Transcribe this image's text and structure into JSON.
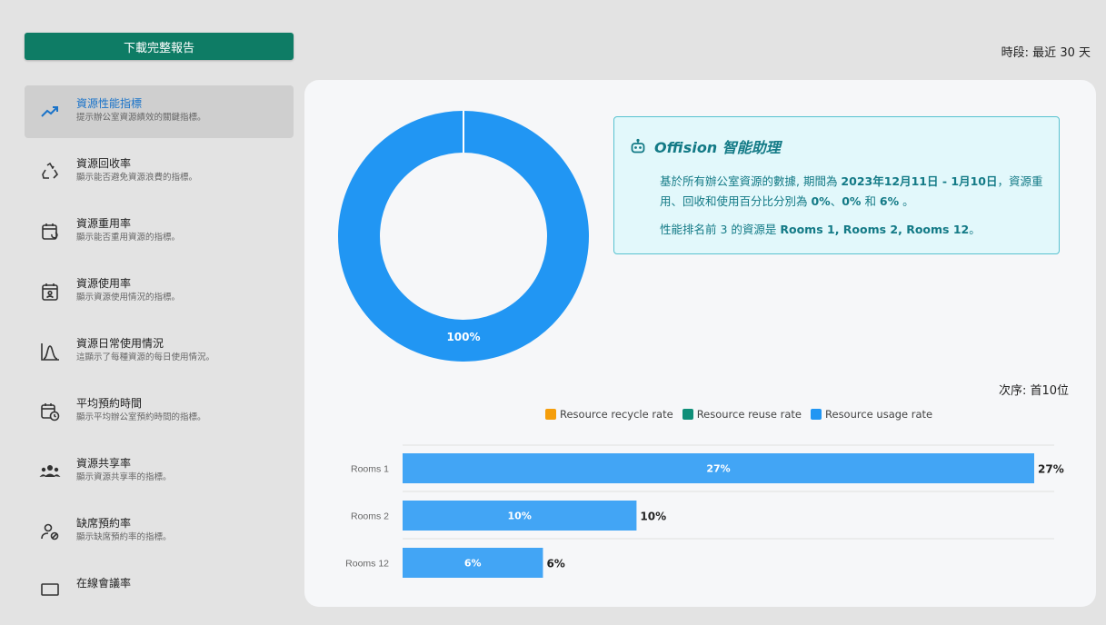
{
  "download_label": "下載完整報告",
  "period": "時段: 最近 30 天",
  "sidebar": [
    {
      "title": "資源性能指標",
      "desc": "提示辦公室資源績效的關鍵指標。",
      "icon": "trending-up-icon",
      "active": true
    },
    {
      "title": "資源回收率",
      "desc": "顯示能否避免資源浪費的指標。",
      "icon": "recycle-icon",
      "active": false
    },
    {
      "title": "資源重用率",
      "desc": "顯示能否重用資源的指標。",
      "icon": "calendar-reuse-icon",
      "active": false
    },
    {
      "title": "資源使用率",
      "desc": "顯示資源使用情況的指標。",
      "icon": "calendar-user-icon",
      "active": false
    },
    {
      "title": "資源日常使用情況",
      "desc": "這顯示了每種資源的每日使用情況。",
      "icon": "bell-curve-icon",
      "active": false
    },
    {
      "title": "平均預約時間",
      "desc": "顯示平均辦公室預約時間的指標。",
      "icon": "calendar-clock-icon",
      "active": false
    },
    {
      "title": "資源共享率",
      "desc": "顯示資源共享率的指標。",
      "icon": "group-icon",
      "active": false
    },
    {
      "title": "缺席預約率",
      "desc": "顯示缺席預約率的指標。",
      "icon": "user-block-icon",
      "active": false
    },
    {
      "title": "在線會議率",
      "desc": "",
      "icon": "monitor-icon",
      "active": false
    }
  ],
  "assistant": {
    "title": "Offision 智能助理",
    "icon": "robot-icon",
    "p1_a": "基於所有辦公室資源的數據, 期間為 ",
    "p1_dates": "2023年12月11日 - 1月10日",
    "p1_b": "，資源重用、回收和使用百分比分別為 ",
    "p1_v1": "0%",
    "p1_sep": "、",
    "p1_v2": "0%",
    "p1_and": " 和 ",
    "p1_v3": "6%",
    "p1_end": " 。",
    "p2_a": "性能排名前 3 的資源是 ",
    "p2_b": "Rooms 1, Rooms 2, Rooms 12",
    "p2_end": "。"
  },
  "order": "次序: 首10位",
  "colors": {
    "recycle": "#f59e0b",
    "reuse": "#0f8f79",
    "usage": "#2196f3",
    "usage_bar": "#42a5f5"
  },
  "chart_data": [
    {
      "type": "pie",
      "labels": [
        "Resource usage rate"
      ],
      "values": [
        100
      ],
      "data_labels": [
        "100%"
      ]
    },
    {
      "type": "bar",
      "orientation": "horizontal",
      "legend": [
        "Resource recycle rate",
        "Resource reuse rate",
        "Resource usage rate"
      ],
      "categories": [
        "Rooms 1",
        "Rooms 2",
        "Rooms 12"
      ],
      "series": [
        {
          "name": "Resource usage rate",
          "values": [
            27,
            10,
            6
          ]
        }
      ],
      "data_labels": [
        "27%",
        "10%",
        "6%"
      ],
      "xlim": [
        0,
        27
      ]
    }
  ]
}
